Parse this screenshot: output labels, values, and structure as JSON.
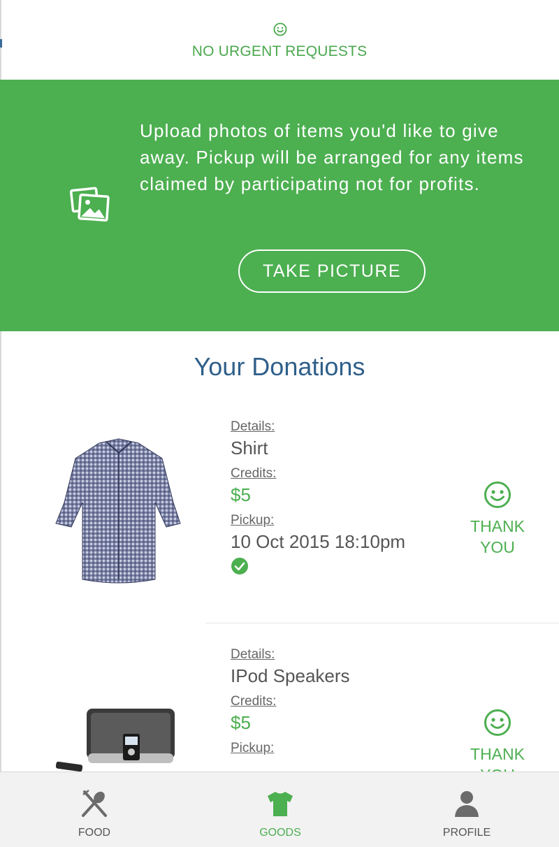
{
  "urgent": {
    "label": "NO URGENT REQUESTS",
    "icon": "smiley-icon"
  },
  "hero": {
    "text": "Upload photos of items you'd like to give away. Pickup will be arranged for any items claimed by participating not for profits.",
    "button_label": "TAKE PICTURE",
    "icon": "photos-icon"
  },
  "donations": {
    "title": "Your Donations",
    "items": [
      {
        "details_label": "Details:",
        "details": "Shirt",
        "credits_label": "Credits:",
        "credits": "$5",
        "pickup_label": "Pickup:",
        "pickup": "10 Oct 2015 18:10pm",
        "status": "THANK YOU",
        "image": "shirt-image"
      },
      {
        "details_label": "Details:",
        "details": "IPod Speakers",
        "credits_label": "Credits:",
        "credits": "$5",
        "pickup_label": "Pickup:",
        "status": "THANK YOU",
        "image": "speaker-image"
      }
    ]
  },
  "tabs": [
    {
      "label": "FOOD",
      "icon": "utensils-icon",
      "active": false
    },
    {
      "label": "GOODS",
      "icon": "tshirt-icon",
      "active": true
    },
    {
      "label": "PROFILE",
      "icon": "person-icon",
      "active": false
    }
  ],
  "colors": {
    "accent": "#4caf50",
    "title": "#2f5f8a"
  }
}
